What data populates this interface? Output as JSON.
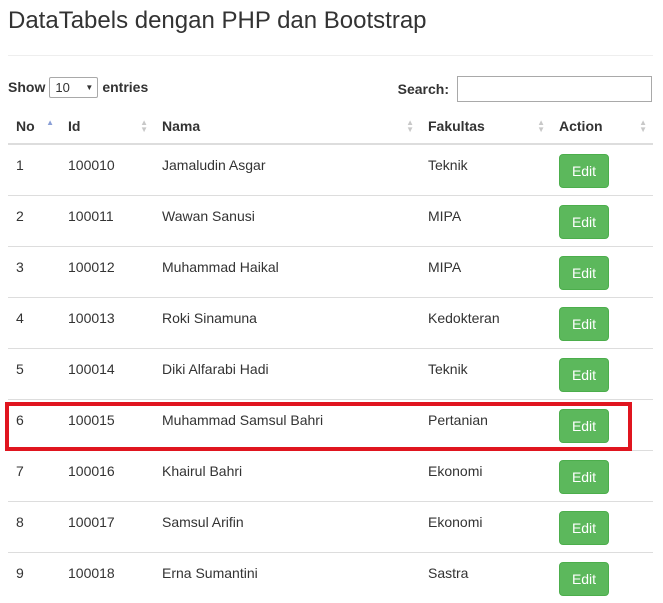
{
  "page": {
    "title": "DataTabels dengan PHP dan Bootstrap"
  },
  "controls": {
    "show_label": "Show",
    "entries_value": "10",
    "entries_label": "entries",
    "search_label": "Search:",
    "search_value": ""
  },
  "table": {
    "columns": [
      "No",
      "Id",
      "Nama",
      "Fakultas",
      "Action"
    ],
    "sorted_column": "No",
    "rows": [
      {
        "no": "1",
        "id": "100010",
        "nama": "Jamaludin Asgar",
        "fakultas": "Teknik",
        "action": "Edit"
      },
      {
        "no": "2",
        "id": "100011",
        "nama": "Wawan Sanusi",
        "fakultas": "MIPA",
        "action": "Edit"
      },
      {
        "no": "3",
        "id": "100012",
        "nama": "Muhammad Haikal",
        "fakultas": "MIPA",
        "action": "Edit"
      },
      {
        "no": "4",
        "id": "100013",
        "nama": "Roki Sinamuna",
        "fakultas": "Kedokteran",
        "action": "Edit"
      },
      {
        "no": "5",
        "id": "100014",
        "nama": "Diki Alfarabi Hadi",
        "fakultas": "Teknik",
        "action": "Edit"
      },
      {
        "no": "6",
        "id": "100015",
        "nama": "Muhammad Samsul Bahri",
        "fakultas": "Pertanian",
        "action": "Edit"
      },
      {
        "no": "7",
        "id": "100016",
        "nama": "Khairul Bahri",
        "fakultas": "Ekonomi",
        "action": "Edit"
      },
      {
        "no": "8",
        "id": "100017",
        "nama": "Samsul Arifin",
        "fakultas": "Ekonomi",
        "action": "Edit"
      },
      {
        "no": "9",
        "id": "100018",
        "nama": "Erna Sumantini",
        "fakultas": "Sastra",
        "action": "Edit"
      }
    ]
  },
  "colors": {
    "edit_button": "#5cb85c",
    "highlight_border": "#e0151f",
    "sort_active": "#8a9fd6"
  },
  "icons": {
    "sort": "sort-both-icon",
    "sort_asc": "sort-asc-icon",
    "select_caret": "caret-down-icon"
  }
}
